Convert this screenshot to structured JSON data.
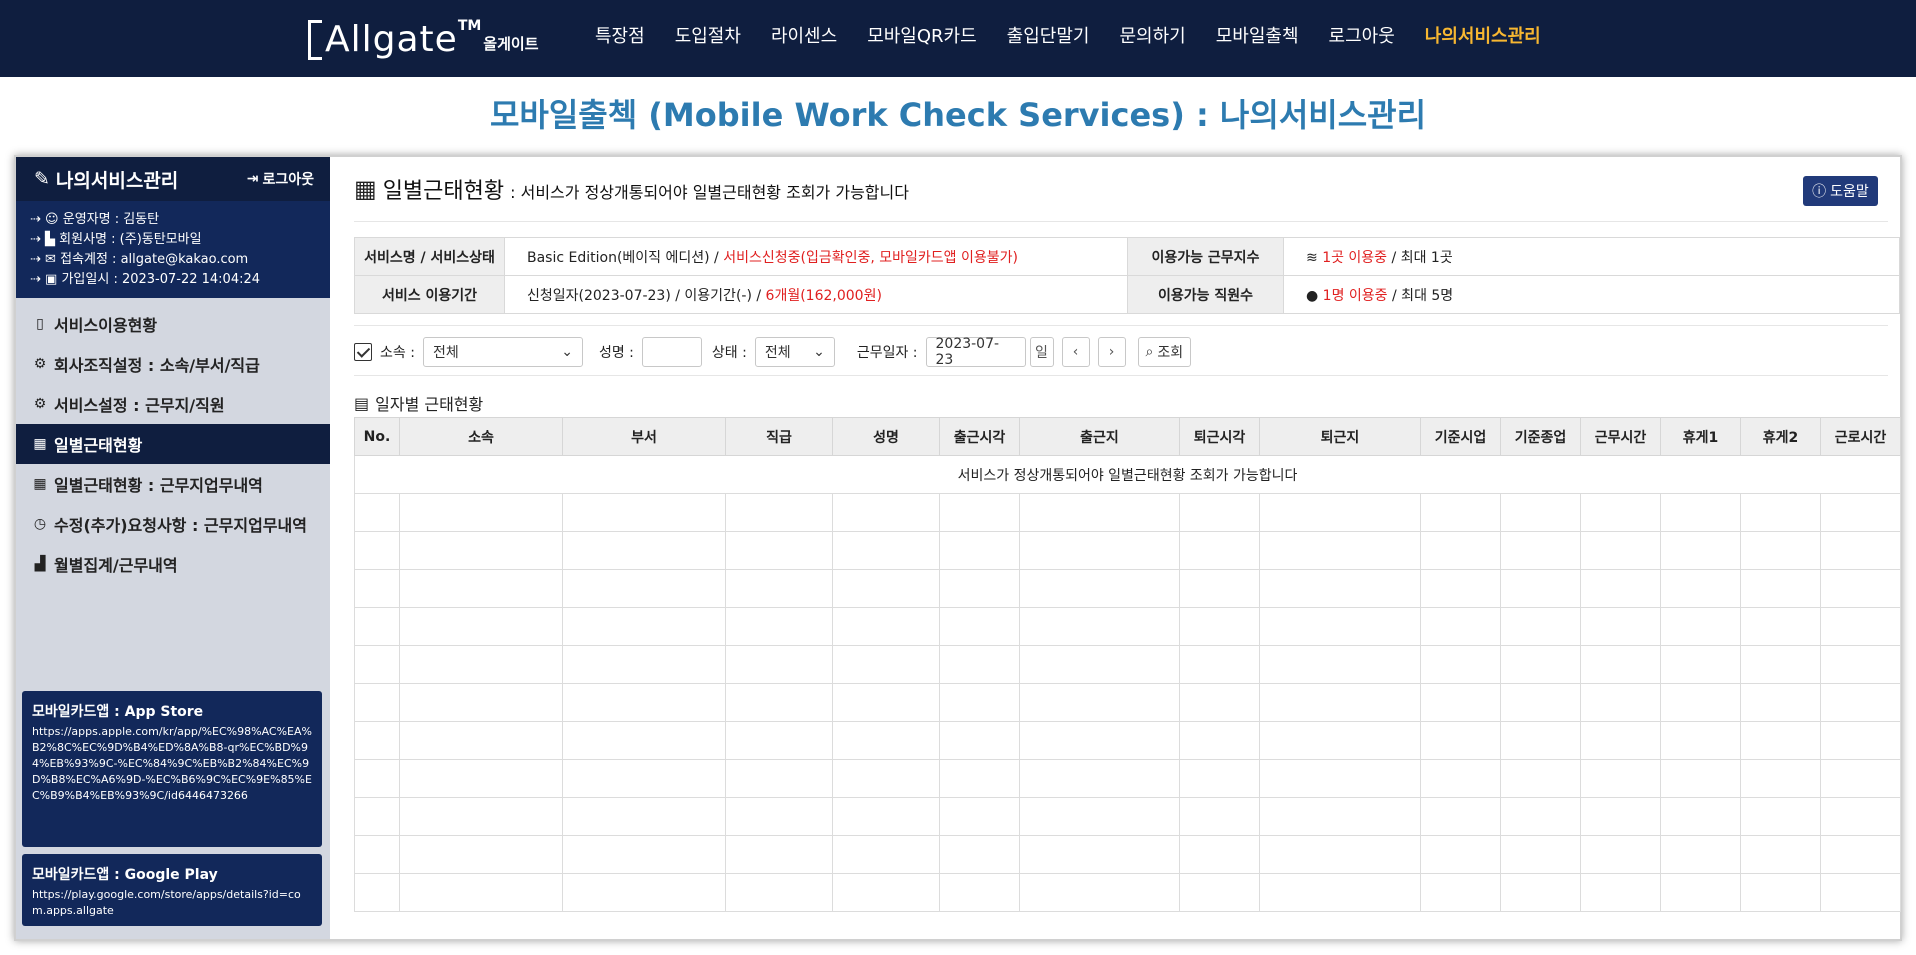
{
  "logo": {
    "brand": "Allgate",
    "tm": "TM",
    "kor": "올게이트"
  },
  "nav": [
    {
      "label": "특장점"
    },
    {
      "label": "도입절차"
    },
    {
      "label": "라이센스"
    },
    {
      "label": "모바일QR카드"
    },
    {
      "label": "출입단말기"
    },
    {
      "label": "문의하기"
    },
    {
      "label": "모바일출첵"
    },
    {
      "label": "로그아웃"
    },
    {
      "label": "나의서비스관리",
      "active": true
    }
  ],
  "page_title": "모바일출첵 (Mobile Work Check Services) : 나의서비스관리",
  "sidebar": {
    "title": "나의서비스관리",
    "logout": "로그아웃",
    "info": [
      "운영자명 : 김동탄",
      "회원사명 : (주)동탄모바일",
      "접속계정 : allgate@kakao.com",
      "가입일시 : 2023-07-22 14:04:24"
    ],
    "items": [
      {
        "label": "서비스이용현황",
        "icon": "clipboard-icon"
      },
      {
        "label": "회사조직설정 : 소속/부서/직급",
        "icon": "gear-icon"
      },
      {
        "label": "서비스설정 : 근무지/직원",
        "icon": "gear-icon"
      },
      {
        "label": "일별근태현황",
        "icon": "calendar-icon"
      },
      {
        "label": "일별근태현황 : 근무지업무내역",
        "icon": "calendar-icon"
      },
      {
        "label": "수정(추가)요청사항 : 근무지업무내역",
        "icon": "clock-icon"
      },
      {
        "label": "월별집계/근무내역",
        "icon": "bar-chart-icon"
      }
    ],
    "app_store": {
      "title": "모바일카드앱 : App Store",
      "url": "https://apps.apple.com/kr/app/%EC%98%AC%EA%B2%8C%EC%9D%B4%ED%8A%B8-qr%EC%BD%94%EB%93%9C-%EC%84%9C%EB%B2%84%EC%9D%B8%EC%A6%9D-%EC%B6%9C%EC%9E%85%EC%B9%B4%EB%93%9C/id6446473266"
    },
    "google_play": {
      "title": "모바일카드앱 : Google Play",
      "url": "https://play.google.com/store/apps/details?id=com.apps.allgate"
    }
  },
  "content": {
    "title": "일별근태현황",
    "subtitle": ": 서비스가 정상개통되어야 일별근태현황 조회가 가능합니다",
    "help": "도움말",
    "info": {
      "service_label": "서비스명 / 서비스상태",
      "service_value": "Basic Edition(베이직 에디션) /",
      "service_status": "서비스신청중(입금확인중, 모바일카드앱 이용불가)",
      "workplace_label": "이용가능 근무지수",
      "workplace_used": "1곳 이용중",
      "workplace_max": "/ 최대 1곳",
      "period_label": "서비스 이용기간",
      "period_value": "신청일자(2023-07-23) / 이용기간(-) /",
      "period_plan": "6개월(162,000원)",
      "staff_label": "이용가능 직원수",
      "staff_used": "1명 이용중",
      "staff_max": "/ 최대 5명"
    },
    "filter": {
      "affil_label": "소속 :",
      "affil_value": "전체",
      "name_label": "성명 :",
      "name_value": "",
      "status_label": "상태 :",
      "status_value": "전체",
      "date_label": "근무일자 :",
      "date_value": "2023-07-23",
      "day_btn": "일",
      "search_btn": "조회"
    },
    "list_title": "일자별 근태현황",
    "columns": [
      "No.",
      "소속",
      "부서",
      "직급",
      "성명",
      "출근시각",
      "출근지",
      "퇴근시각",
      "퇴근지",
      "기준시업",
      "기준종업",
      "근무시간",
      "휴게1",
      "휴게2",
      "근로시간"
    ],
    "empty_message": "서비스가 정상개통되어야 일별근태현황 조회가 가능합니다"
  },
  "colors": {
    "nav_bg": "#0f1e3f",
    "active_nav": "#f7b731",
    "title": "#2d7bb0",
    "status_red": "#e02020"
  }
}
